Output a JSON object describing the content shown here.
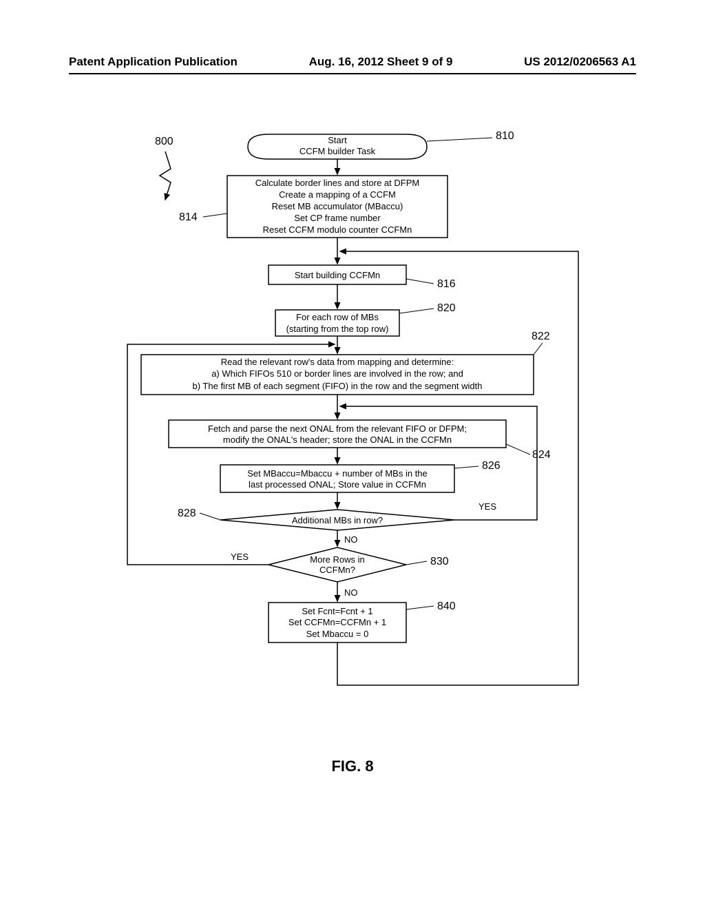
{
  "header": {
    "left": "Patent Application Publication",
    "center": "Aug. 16, 2012   Sheet 9 of 9",
    "right": "US 2012/0206563 A1"
  },
  "figure_label": "FIG. 8",
  "refs": {
    "r800": "800",
    "r810": "810",
    "r814": "814",
    "r816": "816",
    "r820": "820",
    "r822": "822",
    "r824": "824",
    "r826": "826",
    "r828": "828",
    "r830": "830",
    "r840": "840"
  },
  "boxes": {
    "start": {
      "line1": "Start",
      "line2": "CCFM builder Task"
    },
    "b814": {
      "l1": "Calculate border lines and store at DFPM",
      "l2": "Create a mapping of a CCFM",
      "l3": "Reset MB accumulator (MBaccu)",
      "l4": "Set CP frame number",
      "l5": "Reset CCFM modulo counter CCFMn"
    },
    "b816": "Start building CCFMn",
    "b820": {
      "l1": "For each row of MBs",
      "l2": "(starting from the top row)"
    },
    "b822": {
      "l1": "Read the relevant row's data from mapping and determine:",
      "l2": "a) Which FIFOs 510 or border lines are involved in the row; and",
      "l3": "b) The first MB of each segment (FIFO) in the row and the segment width"
    },
    "b824": {
      "l1": "Fetch and parse the next ONAL from the relevant FIFO or DFPM;",
      "l2": "modify the ONAL's header; store the ONAL in the CCFMn"
    },
    "b826": {
      "l1": "Set MBaccu=Mbaccu + number of MBs in the",
      "l2": "last processed ONAL; Store value in CCFMn"
    },
    "d828": "Additional MBs in row?",
    "d830": {
      "l1": "More Rows in",
      "l2": "CCFMn?"
    },
    "b840": {
      "l1": "Set Fcnt=Fcnt + 1",
      "l2": "Set CCFMn=CCFMn + 1",
      "l3": "Set Mbaccu = 0"
    }
  },
  "labels": {
    "yes": "YES",
    "no": "NO"
  }
}
